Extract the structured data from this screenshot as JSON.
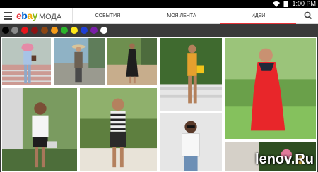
{
  "status": {
    "time": "1:00 PM",
    "wifi_icon": "wifi-icon",
    "battery_icon": "battery-icon"
  },
  "app": {
    "logo_parts": [
      "e",
      "b",
      "a",
      "y"
    ],
    "logo_suffix": "МОДА"
  },
  "tabs": [
    {
      "label": "СОБЫТИЯ",
      "active": false
    },
    {
      "label": "МОЯ ЛЕНТА",
      "active": false
    },
    {
      "label": "ИДЕИ",
      "active": true
    }
  ],
  "colors": [
    "#000000",
    "#8a8a8a",
    "#e8151b",
    "#8c1313",
    "#8b4513",
    "#f59b1a",
    "#2bb52b",
    "#ffe81a",
    "#1f3fd6",
    "#7a1ea8",
    "#ffffff"
  ],
  "accent": "#e53238",
  "watermark": "lenov.Ru"
}
